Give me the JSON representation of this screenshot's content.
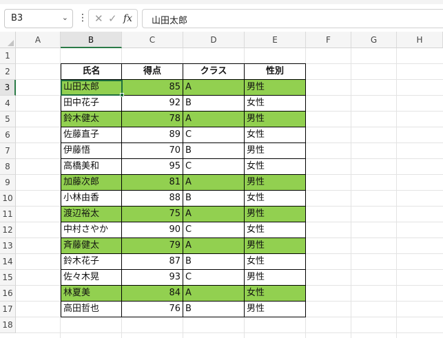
{
  "name_box": {
    "value": "B3",
    "chevron_glyph": "⌄"
  },
  "more_glyph": "⋮",
  "formula_buttons": {
    "cancel_glyph": "✕",
    "enter_glyph": "✓",
    "function_label": "fx"
  },
  "formula_bar": {
    "value": "山田太郎"
  },
  "selected": {
    "column": "B",
    "row": 3
  },
  "highlight_color": "#92d050",
  "column_headers": [
    "A",
    "B",
    "C",
    "D",
    "E",
    "F",
    "G",
    "H"
  ],
  "row_headers": [
    "1",
    "2",
    "3",
    "4",
    "5",
    "6",
    "7",
    "8",
    "9",
    "10",
    "11",
    "12",
    "13",
    "14",
    "15",
    "16",
    "17",
    "18"
  ],
  "table": {
    "headers": [
      "氏名",
      "得点",
      "クラス",
      "性別"
    ],
    "rows": [
      {
        "name": "山田太郎",
        "score": "85",
        "class": "A",
        "gender": "男性",
        "highlight": true
      },
      {
        "name": "田中花子",
        "score": "92",
        "class": "B",
        "gender": "女性",
        "highlight": false
      },
      {
        "name": "鈴木健太",
        "score": "78",
        "class": "A",
        "gender": "男性",
        "highlight": true
      },
      {
        "name": "佐藤直子",
        "score": "89",
        "class": "C",
        "gender": "女性",
        "highlight": false
      },
      {
        "name": "伊藤悟",
        "score": "70",
        "class": "B",
        "gender": "男性",
        "highlight": false
      },
      {
        "name": "高橋美和",
        "score": "95",
        "class": "C",
        "gender": "女性",
        "highlight": false
      },
      {
        "name": "加藤次郎",
        "score": "81",
        "class": "A",
        "gender": "男性",
        "highlight": true
      },
      {
        "name": "小林由香",
        "score": "88",
        "class": "B",
        "gender": "女性",
        "highlight": false
      },
      {
        "name": "渡辺裕太",
        "score": "75",
        "class": "A",
        "gender": "男性",
        "highlight": true
      },
      {
        "name": "中村さやか",
        "score": "90",
        "class": "C",
        "gender": "女性",
        "highlight": false
      },
      {
        "name": "斉藤健太",
        "score": "79",
        "class": "A",
        "gender": "男性",
        "highlight": true
      },
      {
        "name": "鈴木花子",
        "score": "87",
        "class": "B",
        "gender": "女性",
        "highlight": false
      },
      {
        "name": "佐々木晃",
        "score": "93",
        "class": "C",
        "gender": "男性",
        "highlight": false
      },
      {
        "name": "林夏美",
        "score": "84",
        "class": "A",
        "gender": "女性",
        "highlight": true
      },
      {
        "name": "高田哲也",
        "score": "76",
        "class": "B",
        "gender": "男性",
        "highlight": false
      }
    ]
  }
}
